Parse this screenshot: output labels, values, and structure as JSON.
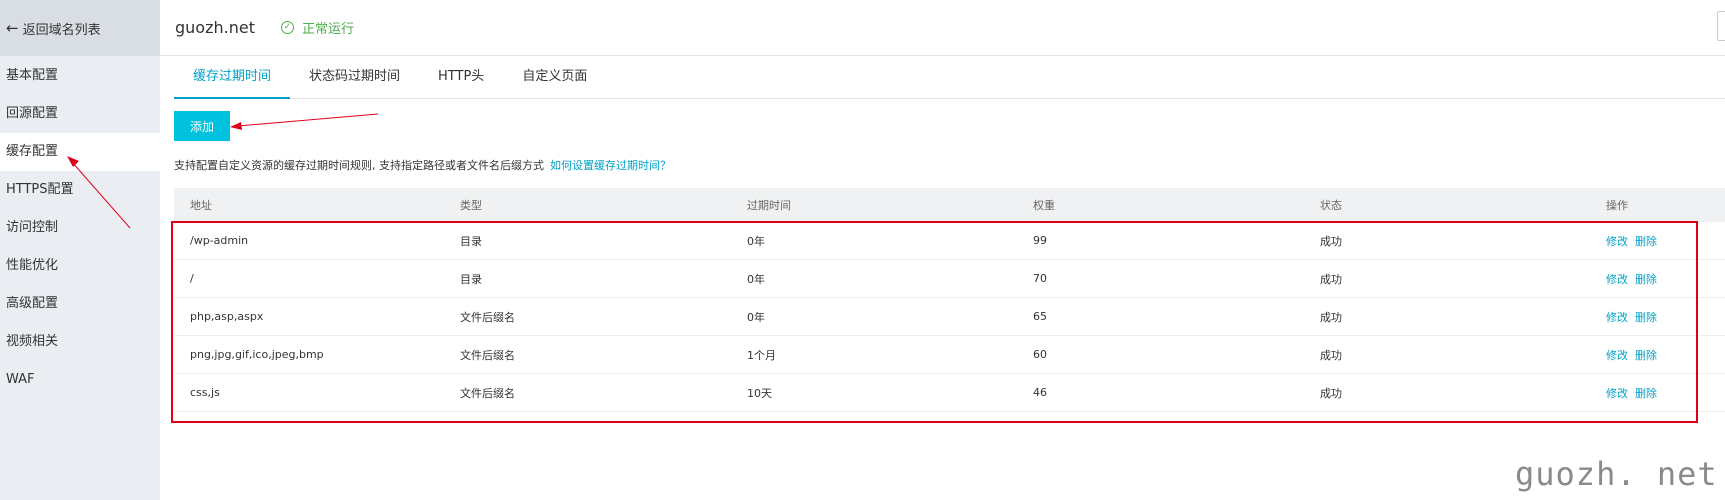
{
  "sidebar": {
    "back_label": "返回域名列表",
    "items": [
      {
        "label": "基本配置"
      },
      {
        "label": "回源配置"
      },
      {
        "label": "缓存配置"
      },
      {
        "label": "HTTPS配置"
      },
      {
        "label": "访问控制"
      },
      {
        "label": "性能优化"
      },
      {
        "label": "高级配置"
      },
      {
        "label": "视频相关"
      },
      {
        "label": "WAF"
      }
    ]
  },
  "header": {
    "domain": "guozh.net",
    "status": "正常运行"
  },
  "tabs": [
    {
      "label": "缓存过期时间"
    },
    {
      "label": "状态码过期时间"
    },
    {
      "label": "HTTP头"
    },
    {
      "label": "自定义页面"
    }
  ],
  "add_button": "添加",
  "description": {
    "text": "支持配置自定义资源的缓存过期时间规则, 支持指定路径或者文件名后缀方式",
    "link": "如何设置缓存过期时间？"
  },
  "table": {
    "columns": [
      "地址",
      "类型",
      "过期时间",
      "权重",
      "状态",
      "操作"
    ],
    "rows": [
      {
        "address": "/wp-admin",
        "type": "目录",
        "expire": "0年",
        "weight": "99",
        "status": "成功"
      },
      {
        "address": "/",
        "type": "目录",
        "expire": "0年",
        "weight": "70",
        "status": "成功"
      },
      {
        "address": "php,asp,aspx",
        "type": "文件后缀名",
        "expire": "0年",
        "weight": "65",
        "status": "成功"
      },
      {
        "address": "png,jpg,gif,ico,jpeg,bmp",
        "type": "文件后缀名",
        "expire": "1个月",
        "weight": "60",
        "status": "成功"
      },
      {
        "address": "css,js",
        "type": "文件后缀名",
        "expire": "10天",
        "weight": "46",
        "status": "成功"
      }
    ],
    "actions": {
      "edit": "修改",
      "delete": "删除"
    }
  },
  "watermark": "guozh. net",
  "colors": {
    "accent": "#00a2ca",
    "button": "#00c1de",
    "success": "#4cae4c",
    "annotation": "#e0001b",
    "sidebar_bg": "#eaedf1"
  }
}
